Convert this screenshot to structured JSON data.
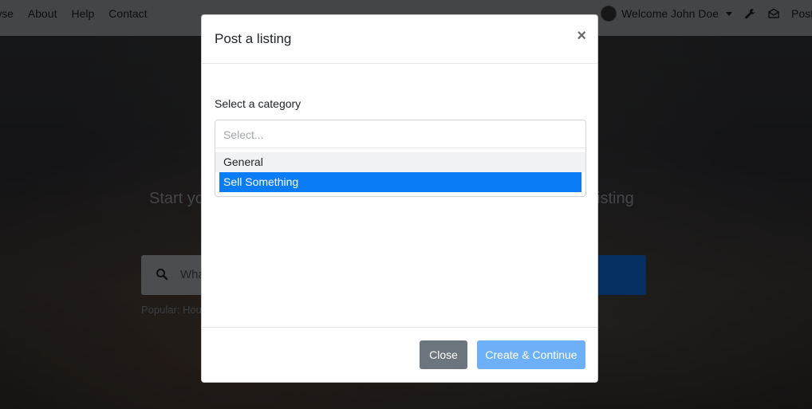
{
  "navbar": {
    "links": [
      "wse",
      "About",
      "Help",
      "Contact"
    ],
    "welcome": "Welcome John Doe",
    "post": "Post"
  },
  "hero": {
    "title_left": "Start yo",
    "title_right": "isting",
    "search_placeholder": "Wha",
    "popular": "Popular: Hou"
  },
  "modal": {
    "title": "Post a listing",
    "close_glyph": "×",
    "field_label": "Select a category",
    "select_placeholder": "Select...",
    "options": [
      "General",
      "Sell Something"
    ],
    "selected_option": "Sell Something",
    "buttons": {
      "close": "Close",
      "create": "Create & Continue"
    }
  },
  "colors": {
    "accent": "#0a7cf5",
    "secondary_button": "#6c757d",
    "primary_button_disabled": "#6eb0f7"
  },
  "icons": [
    "search-icon",
    "wrench-icon",
    "mail-icon",
    "caret-down-icon",
    "close-icon"
  ]
}
